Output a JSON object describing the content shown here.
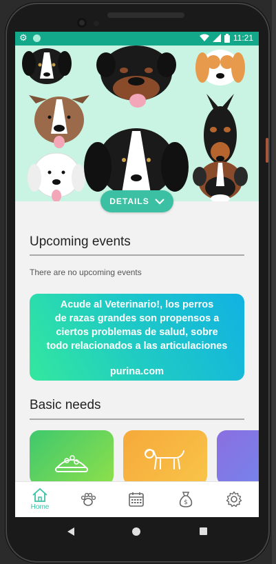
{
  "status_bar": {
    "time": "11:21"
  },
  "hero": {
    "details_label": "DETAILS"
  },
  "upcoming": {
    "title": "Upcoming events",
    "empty_text": "There are no upcoming events"
  },
  "banner": {
    "message_lines": [
      "Acude al Veterinario!, los perros",
      "de razas grandes son propensos a",
      "ciertos problemas de salud, sobre",
      "todo relacionados a las articulaciones"
    ],
    "source": "purina.com"
  },
  "basic_needs": {
    "title": "Basic needs"
  },
  "bottom_nav": {
    "items": [
      {
        "label": "Home",
        "icon": "home-icon",
        "active": true
      },
      {
        "label": "",
        "icon": "paw-icon",
        "active": false
      },
      {
        "label": "",
        "icon": "calendar-icon",
        "active": false
      },
      {
        "label": "",
        "icon": "money-bag-icon",
        "active": false
      },
      {
        "label": "",
        "icon": "gear-icon",
        "active": false
      }
    ]
  },
  "colors": {
    "primary": "#14a88a",
    "accent": "#3cc0a4",
    "hero_bg": "#c9f3e2"
  }
}
